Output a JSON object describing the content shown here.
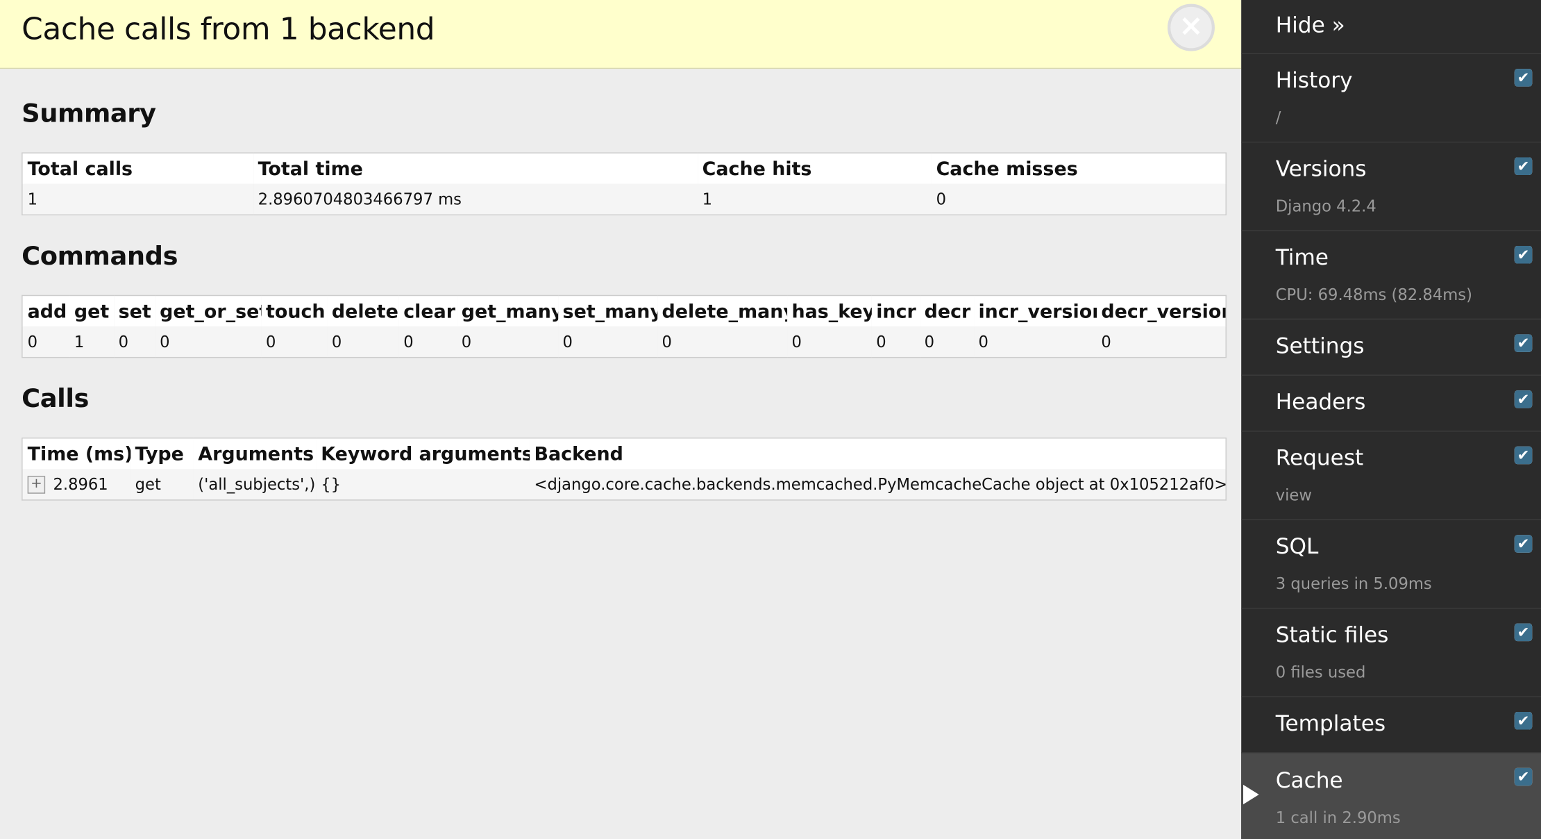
{
  "panel": {
    "title": "Cache calls from 1 backend",
    "close_glyph": "×"
  },
  "summary": {
    "heading": "Summary",
    "headers": [
      "Total calls",
      "Total time",
      "Cache hits",
      "Cache misses"
    ],
    "row": [
      "1",
      "2.8960704803466797 ms",
      "1",
      "0"
    ]
  },
  "commands": {
    "heading": "Commands",
    "headers": [
      "add",
      "get",
      "set",
      "get_or_set",
      "touch",
      "delete",
      "clear",
      "get_many",
      "set_many",
      "delete_many",
      "has_key",
      "incr",
      "decr",
      "incr_version",
      "decr_version"
    ],
    "row": [
      "0",
      "1",
      "0",
      "0",
      "0",
      "0",
      "0",
      "0",
      "0",
      "0",
      "0",
      "0",
      "0",
      "0",
      "0"
    ]
  },
  "calls": {
    "heading": "Calls",
    "headers": [
      "Time (ms)",
      "Type",
      "Arguments",
      "Keyword arguments",
      "Backend"
    ],
    "rows": [
      {
        "toggle": "+",
        "time": "2.8961",
        "type": "get",
        "arguments": "('all_subjects',)",
        "kwargs": "{}",
        "backend": "<django.core.cache.backends.memcached.PyMemcacheCache object at 0x105212af0>"
      }
    ]
  },
  "sidebar": {
    "hide_label": "Hide »",
    "check_glyph": "✔",
    "items": [
      {
        "label": "History",
        "sub": "/"
      },
      {
        "label": "Versions",
        "sub": "Django 4.2.4"
      },
      {
        "label": "Time",
        "sub": "CPU: 69.48ms (82.84ms)"
      },
      {
        "label": "Settings",
        "sub": ""
      },
      {
        "label": "Headers",
        "sub": ""
      },
      {
        "label": "Request",
        "sub": "view"
      },
      {
        "label": "SQL",
        "sub": "3 queries in 5.09ms"
      },
      {
        "label": "Static files",
        "sub": "0 files used"
      },
      {
        "label": "Templates",
        "sub": ""
      },
      {
        "label": "Cache",
        "sub": "1 call in 2.90ms"
      }
    ]
  },
  "colors": {
    "title_bar": "#ffffcc",
    "sidebar_bg": "#2b2b2b",
    "sidebar_active": "#4a4a4a",
    "checkbox_accent": "#3b6e8c"
  }
}
